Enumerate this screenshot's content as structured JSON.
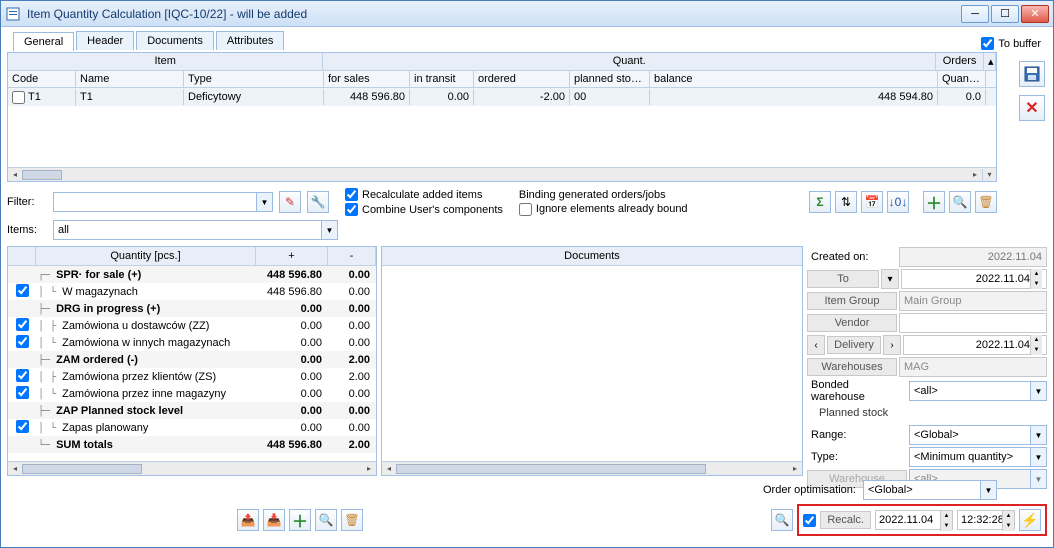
{
  "window": {
    "title": "Item Quantity Calculation [IQC-10/22] - will be added"
  },
  "tabs": {
    "general": "General",
    "header": "Header",
    "documents": "Documents",
    "attributes": "Attributes"
  },
  "tobuffer": "To buffer",
  "grid": {
    "group_item": "Item",
    "group_quant": "Quant.",
    "group_orders": "Orders",
    "h_code": "Code",
    "h_name": "Name",
    "h_type": "Type",
    "h_forsales": "for sales",
    "h_intransit": "in transit",
    "h_ordered": "ordered",
    "h_planned": "planned stocks",
    "h_balance": "balance",
    "h_quantity": "Quantity",
    "row": {
      "code": "T1",
      "name": "T1",
      "type": "Deficytowy",
      "forsales": "448 596.80",
      "intransit": "0.00",
      "ordered": "-2.00",
      "planned": "00",
      "balance": "448 594.80",
      "quantity": "0.0"
    }
  },
  "filter": {
    "label": "Filter:",
    "value": "",
    "recalc_added": "Recalculate added items",
    "combine": "Combine User's components",
    "binding": "Binding generated orders/jobs",
    "ignore": "Ignore elements already bound"
  },
  "items": {
    "label": "Items:",
    "value": "all"
  },
  "qty_panel": {
    "h_qty": "Quantity [pcs.]",
    "h_plus": "+",
    "h_minus": "-",
    "rows": [
      {
        "chk": false,
        "label": "SPR· for sale (+)",
        "plus": "448 596.80",
        "minus": "0.00",
        "bold": true,
        "top": true,
        "prefix": "┌─"
      },
      {
        "chk": true,
        "label": "W magazynach",
        "plus": "448 596.80",
        "minus": "0.00",
        "prefix": "│  └"
      },
      {
        "chk": false,
        "label": "DRG in progress (+)",
        "plus": "0.00",
        "minus": "0.00",
        "bold": true,
        "top": true,
        "prefix": "├─"
      },
      {
        "chk": true,
        "label": "Zamówiona u dostawców (ZZ)",
        "plus": "0.00",
        "minus": "0.00",
        "prefix": "│  ├"
      },
      {
        "chk": true,
        "label": "Zamówiona w innych magazynach",
        "plus": "0.00",
        "minus": "0.00",
        "prefix": "│  └"
      },
      {
        "chk": false,
        "label": "ZAM ordered (-)",
        "plus": "0.00",
        "minus": "2.00",
        "bold": true,
        "top": true,
        "prefix": "├─"
      },
      {
        "chk": true,
        "label": "Zamówiona przez klientów (ZS)",
        "plus": "0.00",
        "minus": "2.00",
        "prefix": "│  ├"
      },
      {
        "chk": true,
        "label": "Zamówiona przez inne magazyny",
        "plus": "0.00",
        "minus": "0.00",
        "prefix": "│  └"
      },
      {
        "chk": false,
        "label": "ZAP Planned stock level",
        "plus": "0.00",
        "minus": "0.00",
        "bold": true,
        "top": true,
        "prefix": "├─"
      },
      {
        "chk": true,
        "label": "Zapas planowany",
        "plus": "0.00",
        "minus": "0.00",
        "prefix": "│  └"
      },
      {
        "chk": false,
        "label": "SUM totals",
        "plus": "448 596.80",
        "minus": "2.00",
        "bold": true,
        "top": true,
        "prefix": "└─"
      }
    ]
  },
  "doc_panel": {
    "header": "Documents"
  },
  "side": {
    "created_on_lbl": "Created on:",
    "created_on": "2022.11.04",
    "to_lbl": "To",
    "to": "2022.11.04",
    "item_group_lbl": "Item Group",
    "item_group": "Main Group",
    "vendor_lbl": "Vendor",
    "vendor": "",
    "delivery_lbl": "Delivery",
    "delivery": "2022.11.04",
    "warehouses_lbl": "Warehouses",
    "warehouses": "MAG",
    "bonded_lbl": "Bonded warehouse",
    "bonded": "<all>",
    "planned_lbl": "Planned stock",
    "range_lbl": "Range:",
    "range": "<Global>",
    "type_lbl": "Type:",
    "type": "<Minimum quantity>",
    "warehouse_lbl": "Warehouse",
    "warehouse": "<all>",
    "order_opt_lbl": "Order optimisation:",
    "order_opt": "<Global>"
  },
  "recalc": {
    "label": "Recalc.",
    "date": "2022.11.04",
    "time": "12:32:28"
  }
}
